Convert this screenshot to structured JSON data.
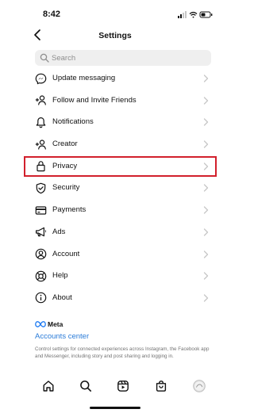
{
  "status_bar": {
    "time": "8:42"
  },
  "header": {
    "title": "Settings"
  },
  "search": {
    "placeholder": "Search"
  },
  "menu": {
    "items": [
      {
        "label": "Update messaging",
        "icon": "messenger-icon"
      },
      {
        "label": "Follow and Invite Friends",
        "icon": "add-person-icon"
      },
      {
        "label": "Notifications",
        "icon": "bell-icon"
      },
      {
        "label": "Creator",
        "icon": "add-person-icon"
      },
      {
        "label": "Privacy",
        "icon": "lock-icon"
      },
      {
        "label": "Security",
        "icon": "shield-icon"
      },
      {
        "label": "Payments",
        "icon": "card-icon"
      },
      {
        "label": "Ads",
        "icon": "megaphone-icon"
      },
      {
        "label": "Account",
        "icon": "account-circle-icon"
      },
      {
        "label": "Help",
        "icon": "lifebuoy-icon"
      },
      {
        "label": "About",
        "icon": "info-icon"
      }
    ]
  },
  "meta": {
    "logo_text": "Meta",
    "accounts_center": "Accounts center",
    "description": "Control settings for connected experiences across Instagram, the Facebook app and Messenger, including story and post sharing and logging in."
  },
  "bottom_nav": {
    "items": [
      "home-icon",
      "search-icon",
      "reels-icon",
      "shop-icon",
      "profile-avatar"
    ]
  },
  "colors": {
    "highlight": "#d2202c",
    "link": "#2a7bd8",
    "chevron": "#c7c7c7",
    "search_bg": "#efefef"
  }
}
